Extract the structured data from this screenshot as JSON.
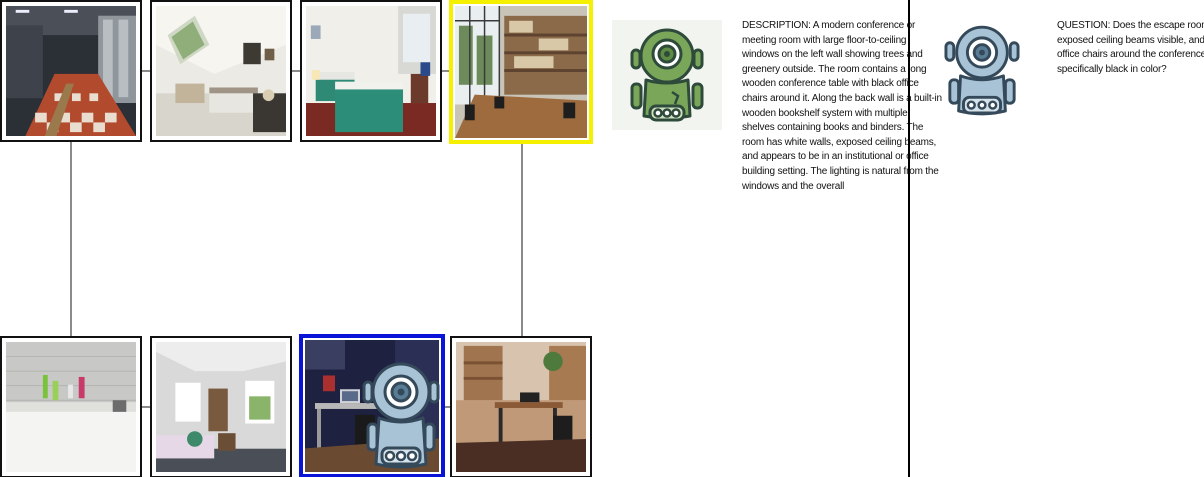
{
  "gallery": {
    "top_row": [
      {
        "id": "locker-room",
        "selected": false
      },
      {
        "id": "attic-bedroom",
        "selected": false
      },
      {
        "id": "hotel-room",
        "selected": false
      },
      {
        "id": "conference-room",
        "selected": true,
        "highlight": "#f5ef00"
      }
    ],
    "bottom_row": [
      {
        "id": "bathroom",
        "selected": false
      },
      {
        "id": "dormer-bedroom",
        "selected": false
      },
      {
        "id": "computer-desk-room",
        "selected": true,
        "highlight": "#0a14d8"
      },
      {
        "id": "home-office",
        "selected": false
      }
    ]
  },
  "agents": {
    "describer_icon": "green-robot-icon",
    "questioner_icon": "blue-robot-icon",
    "describer_color": "#7aa65a",
    "questioner_color": "#a9c3d6"
  },
  "description": {
    "text": "DESCRIPTION: A modern conference or meeting room with large floor-to-ceiling windows on the left wall showing trees and greenery outside. The room contains a long wooden conference table with black office chairs around it. Along the back wall is a built-in wooden bookshelf system with multiple shelves containing books and binders. The room has white walls, exposed ceiling beams, and appears to be in an institutional or office building setting. The lighting is natural from the windows and the overall"
  },
  "question": {
    "lines": [
      "QUESTION: Does the escape room have",
      "exposed ceiling beams visible, and are the",
      "office chairs around the conference table",
      "specifically black in color?"
    ]
  }
}
